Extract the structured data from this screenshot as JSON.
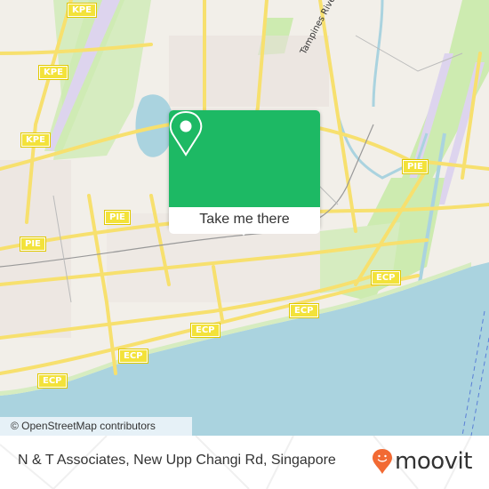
{
  "map": {
    "highway_labels": [
      {
        "id": "kpe-1",
        "text": "KPE"
      },
      {
        "id": "kpe-2",
        "text": "KPE"
      },
      {
        "id": "kpe-3",
        "text": "KPE"
      },
      {
        "id": "pie-1",
        "text": "PIE"
      },
      {
        "id": "pie-2",
        "text": "PIE"
      },
      {
        "id": "pie-3",
        "text": "PIE"
      },
      {
        "id": "ecp-1",
        "text": "ECP"
      },
      {
        "id": "ecp-2",
        "text": "ECP"
      },
      {
        "id": "ecp-3",
        "text": "ECP"
      },
      {
        "id": "ecp-4",
        "text": "ECP"
      },
      {
        "id": "ecp-5",
        "text": "ECP"
      }
    ],
    "river_label": "Tampines River",
    "attribution": "© OpenStreetMap contributors",
    "colors": {
      "land": "#f2efe9",
      "sea": "#aad3df",
      "park": "#cdebb0",
      "road": "#f7e06e",
      "runway": "#ddd4ee"
    }
  },
  "popup": {
    "action_label": "Take me there",
    "icon": "map-pin-icon",
    "accent_color": "#1db964"
  },
  "footer": {
    "place_name": "N & T Associates, New Upp Changi Rd, Singapore",
    "brand": "moovit",
    "brand_color": "#f26a33"
  }
}
